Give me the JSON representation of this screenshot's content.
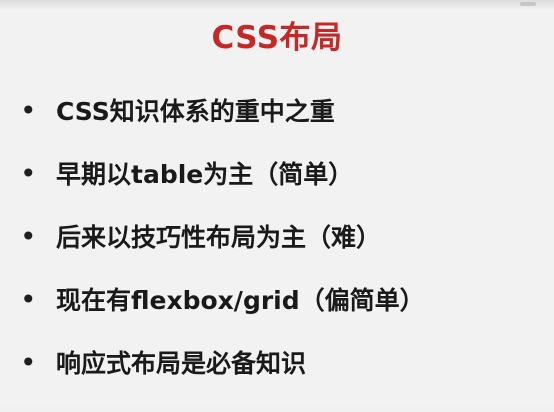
{
  "slide": {
    "title": "CSS布局",
    "title_color": "#c62828",
    "bullet_symbol": "•",
    "bullets": [
      "CSS知识体系的重中之重",
      "早期以table为主（简单）",
      "后来以技巧性布局为主（难）",
      "现在有flexbox/grid（偏简单）",
      "响应式布局是必备知识"
    ]
  }
}
